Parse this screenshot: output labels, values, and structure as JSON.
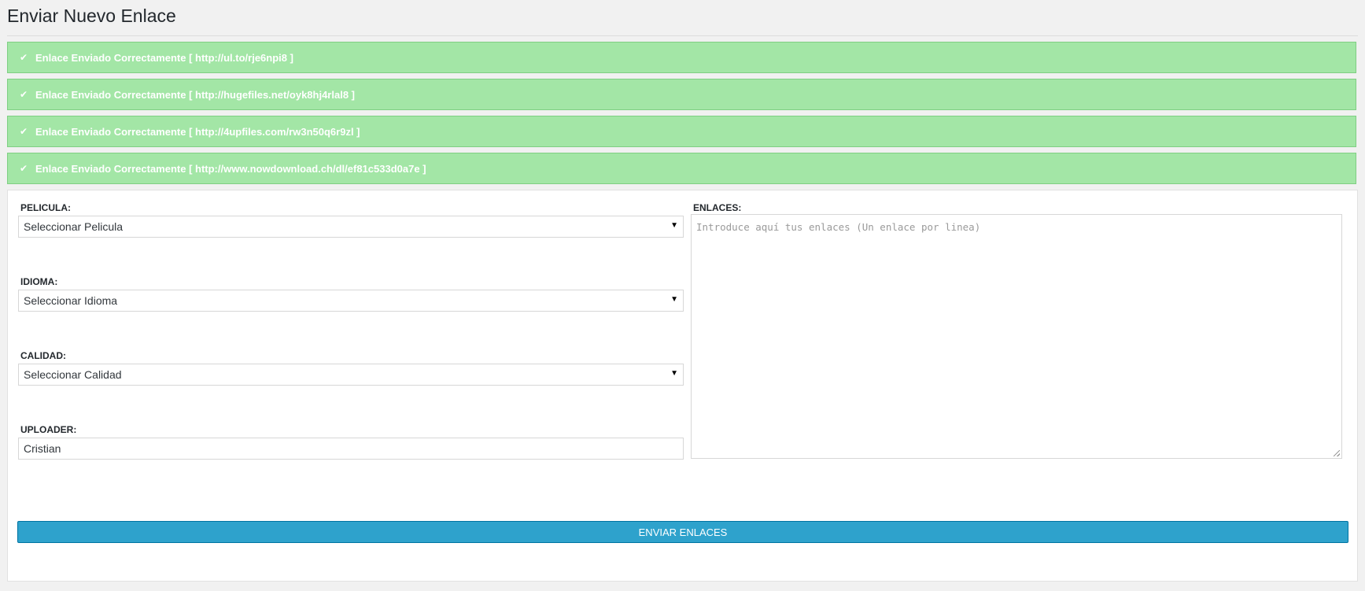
{
  "page": {
    "title": "Enviar Nuevo Enlace"
  },
  "notices": [
    {
      "icon": "check-icon",
      "text": "Enlace Enviado Correctamente [ http://ul.to/rje6npi8 ]"
    },
    {
      "icon": "check-icon",
      "text": "Enlace Enviado Correctamente [ http://hugefiles.net/oyk8hj4rlal8 ]"
    },
    {
      "icon": "check-icon",
      "text": "Enlace Enviado Correctamente [ http://4upfiles.com/rw3n50q6r9zl ]"
    },
    {
      "icon": "check-icon",
      "text": "Enlace Enviado Correctamente [ http://www.nowdownload.ch/dl/ef81c533d0a7e ]"
    }
  ],
  "form": {
    "pelicula": {
      "label": "PELICULA:",
      "value": "Seleccionar Pelicula"
    },
    "idioma": {
      "label": "IDIOMA:",
      "value": "Seleccionar Idioma"
    },
    "calidad": {
      "label": "CALIDAD:",
      "value": "Seleccionar Calidad"
    },
    "uploader": {
      "label": "UPLOADER:",
      "value": "Cristian"
    },
    "enlaces": {
      "label": "ENLACES:",
      "placeholder": "Introduce aquí tus enlaces (Un enlace por linea)"
    },
    "submit_label": "ENVIAR ENLACES"
  },
  "colors": {
    "notice_bg": "#a3e6a6",
    "button_bg": "#2ea2cc",
    "page_bg": "#f1f1f1"
  }
}
